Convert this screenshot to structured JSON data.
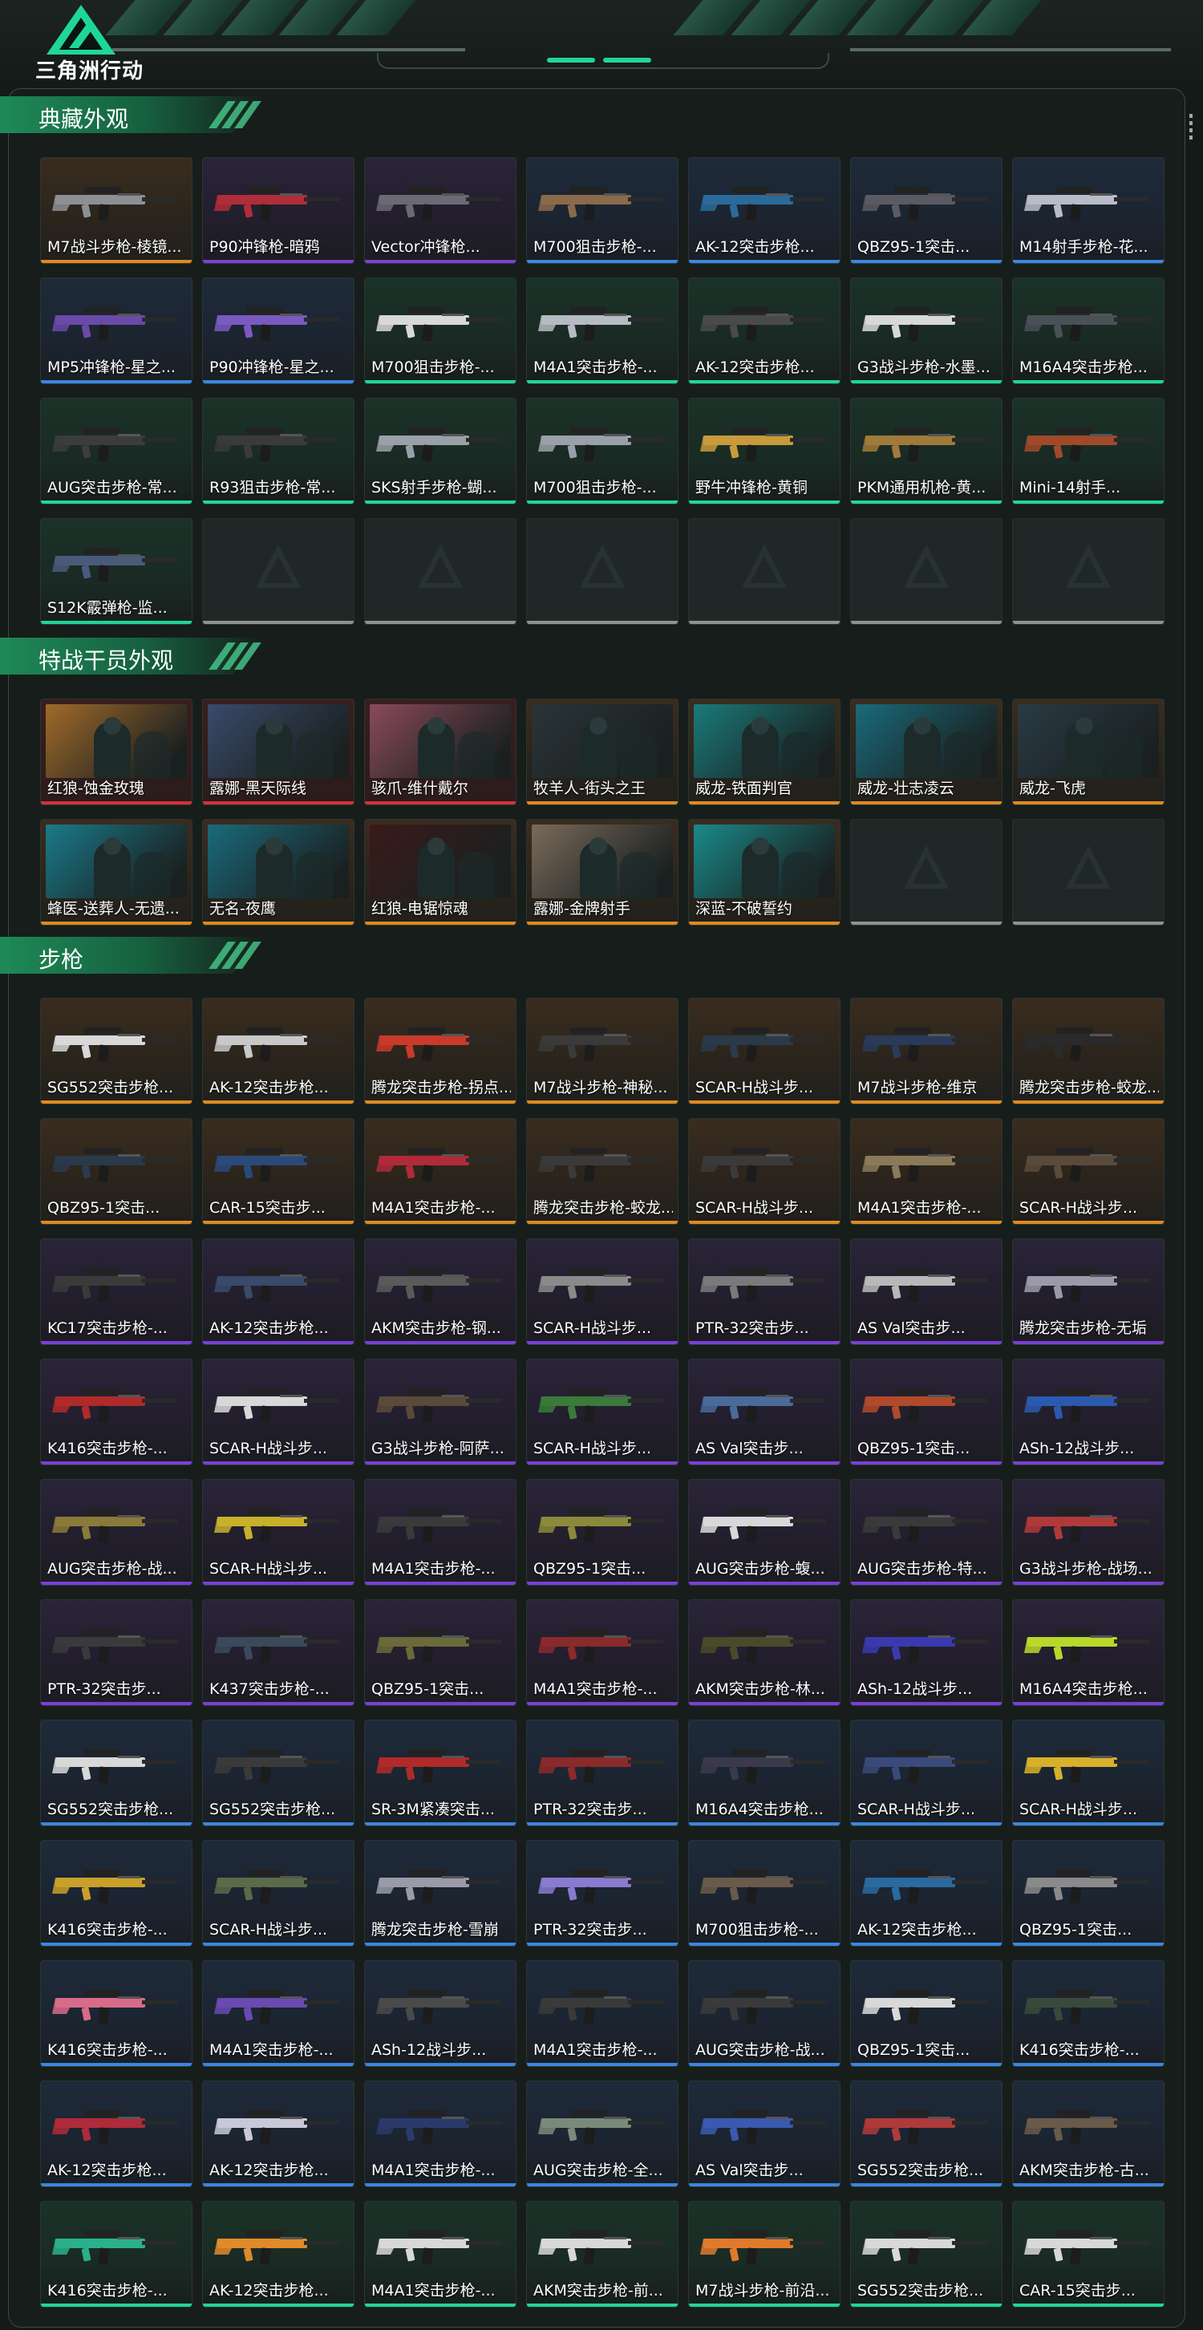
{
  "app": {
    "title": "三角洲行动"
  },
  "colors": {
    "accent": "#1fd69a",
    "gold": "#e08a1c",
    "purple": "#7b3fd6",
    "blue": "#3a86e0",
    "green": "#1fd69a",
    "red": "#d6303a",
    "empty": "#8a9491"
  },
  "sections": [
    {
      "id": "collection",
      "title": "典藏外观",
      "kind": "gun",
      "items": [
        {
          "label": "M7战斗步枪-棱镜...",
          "rarity": "gold",
          "hue": "#8c8f94"
        },
        {
          "label": "P90冲锋枪-暗鸦",
          "rarity": "purple",
          "hue": "#b02d3a"
        },
        {
          "label": "Vector冲锋枪...",
          "rarity": "purple",
          "hue": "#6a6a74"
        },
        {
          "label": "M700狙击步枪-...",
          "rarity": "blue",
          "hue": "#8a6a4a"
        },
        {
          "label": "AK-12突击步枪...",
          "rarity": "blue",
          "hue": "#2a6a9a"
        },
        {
          "label": "QBZ95-1突击...",
          "rarity": "blue",
          "hue": "#5a5a62"
        },
        {
          "label": "M14射手步枪-花...",
          "rarity": "blue",
          "hue": "#b8bcc8"
        },
        {
          "label": "MP5冲锋枪-星之...",
          "rarity": "blue",
          "hue": "#6a4aa8"
        },
        {
          "label": "P90冲锋枪-星之...",
          "rarity": "blue",
          "hue": "#7a5ac0"
        },
        {
          "label": "M700狙击步枪-...",
          "rarity": "green",
          "hue": "#d8d8d8"
        },
        {
          "label": "M4A1突击步枪-...",
          "rarity": "green",
          "hue": "#b6bac2"
        },
        {
          "label": "AK-12突击步枪...",
          "rarity": "green",
          "hue": "#4a4a4a"
        },
        {
          "label": "G3战斗步枪-水墨...",
          "rarity": "green",
          "hue": "#d8d8d8"
        },
        {
          "label": "M16A4突击步枪...",
          "rarity": "green",
          "hue": "#4a5058"
        },
        {
          "label": "AUG突击步枪-常...",
          "rarity": "green",
          "hue": "#3c3c3c"
        },
        {
          "label": "R93狙击步枪-常...",
          "rarity": "green",
          "hue": "#3a3a3a"
        },
        {
          "label": "SKS射手步枪-蝴...",
          "rarity": "green",
          "hue": "#9aa0a8"
        },
        {
          "label": "M700狙击步枪-...",
          "rarity": "green",
          "hue": "#9aa0aa"
        },
        {
          "label": "野牛冲锋枪-黄铜",
          "rarity": "green",
          "hue": "#c89a3a"
        },
        {
          "label": "PKM通用机枪-黄...",
          "rarity": "green",
          "hue": "#a07a3a"
        },
        {
          "label": "Mini-14射手...",
          "rarity": "green",
          "hue": "#a04a2a"
        },
        {
          "label": "S12K霰弹枪-监...",
          "rarity": "green",
          "hue": "#4a5a7a"
        },
        {
          "label": "",
          "rarity": "empty"
        },
        {
          "label": "",
          "rarity": "empty"
        },
        {
          "label": "",
          "rarity": "empty"
        },
        {
          "label": "",
          "rarity": "empty"
        },
        {
          "label": "",
          "rarity": "empty"
        },
        {
          "label": "",
          "rarity": "empty"
        }
      ]
    },
    {
      "id": "operators",
      "title": "特战干员外观",
      "kind": "operator",
      "items": [
        {
          "label": "红狼-蚀金玫瑰",
          "rarity": "red",
          "hue": "#a06a2a"
        },
        {
          "label": "露娜-黑天际线",
          "rarity": "red",
          "hue": "#3a4a6a"
        },
        {
          "label": "骇爪-维什戴尔",
          "rarity": "red",
          "hue": "#8a4a5a"
        },
        {
          "label": "牧羊人-街头之王",
          "rarity": "gold",
          "hue": "#2a3438"
        },
        {
          "label": "威龙-铁面判官",
          "rarity": "gold",
          "hue": "#1a7a7a"
        },
        {
          "label": "威龙-壮志凌云",
          "rarity": "gold",
          "hue": "#1a6a7a"
        },
        {
          "label": "威龙-飞虎",
          "rarity": "gold",
          "hue": "#2a3a44"
        },
        {
          "label": "蜂医-送葬人-无遗...",
          "rarity": "gold",
          "hue": "#1a7a8a"
        },
        {
          "label": "无名-夜鹰",
          "rarity": "gold",
          "hue": "#1a6a7a"
        },
        {
          "label": "红狼-电锯惊魂",
          "rarity": "gold",
          "hue": "#3a1a1a"
        },
        {
          "label": "露娜-金牌射手",
          "rarity": "gold",
          "hue": "#7a6a5a"
        },
        {
          "label": "深蓝-不破誓约",
          "rarity": "gold",
          "hue": "#1a8a8a"
        },
        {
          "label": "",
          "rarity": "empty"
        },
        {
          "label": "",
          "rarity": "empty"
        }
      ]
    },
    {
      "id": "rifles",
      "title": "步枪",
      "kind": "gun",
      "items": [
        {
          "label": "SG552突击步枪...",
          "rarity": "gold",
          "hue": "#d8d8d8"
        },
        {
          "label": "AK-12突击步枪...",
          "rarity": "gold",
          "hue": "#c8c8c8"
        },
        {
          "label": "腾龙突击步枪-拐点...",
          "rarity": "gold",
          "hue": "#c83a2a"
        },
        {
          "label": "M7战斗步枪-神秘...",
          "rarity": "gold",
          "hue": "#3a3a3a"
        },
        {
          "label": "SCAR-H战斗步...",
          "rarity": "gold",
          "hue": "#2a3a4a"
        },
        {
          "label": "M7战斗步枪-维京",
          "rarity": "gold",
          "hue": "#2a3a5a"
        },
        {
          "label": "腾龙突击步枪-蛟龙...",
          "rarity": "gold",
          "hue": "#2a2a2a"
        },
        {
          "label": "QBZ95-1突击...",
          "rarity": "gold",
          "hue": "#2a3a4a"
        },
        {
          "label": "CAR-15突击步...",
          "rarity": "gold",
          "hue": "#2a4a7a"
        },
        {
          "label": "M4A1突击步枪-...",
          "rarity": "gold",
          "hue": "#b02a3a"
        },
        {
          "label": "腾龙突击步枪-蛟龙...",
          "rarity": "gold",
          "hue": "#3a3a3a"
        },
        {
          "label": "SCAR-H战斗步...",
          "rarity": "gold",
          "hue": "#3a3a3a"
        },
        {
          "label": "M4A1突击步枪-...",
          "rarity": "gold",
          "hue": "#8a7a5a"
        },
        {
          "label": "SCAR-H战斗步...",
          "rarity": "gold",
          "hue": "#5a4a3a"
        },
        {
          "label": "KC17突击步枪-...",
          "rarity": "purple",
          "hue": "#3a3a3a"
        },
        {
          "label": "AK-12突击步枪...",
          "rarity": "purple",
          "hue": "#3a4a6a"
        },
        {
          "label": "AKM突击步枪-钢...",
          "rarity": "purple",
          "hue": "#5a5a5a"
        },
        {
          "label": "SCAR-H战斗步...",
          "rarity": "purple",
          "hue": "#8a8a8a"
        },
        {
          "label": "PTR-32突击步...",
          "rarity": "purple",
          "hue": "#7a7a7a"
        },
        {
          "label": "AS Val突击步...",
          "rarity": "purple",
          "hue": "#b8b8b8"
        },
        {
          "label": "腾龙突击步枪-无垢",
          "rarity": "purple",
          "hue": "#9a9aaa"
        },
        {
          "label": "K416突击步枪-...",
          "rarity": "purple",
          "hue": "#b02a2a"
        },
        {
          "label": "SCAR-H战斗步...",
          "rarity": "purple",
          "hue": "#d8d8d8"
        },
        {
          "label": "G3战斗步枪-阿萨...",
          "rarity": "purple",
          "hue": "#5a4a3a"
        },
        {
          "label": "SCAR-H战斗步...",
          "rarity": "purple",
          "hue": "#3a7a3a"
        },
        {
          "label": "AS Val突击步...",
          "rarity": "purple",
          "hue": "#4a6a9a"
        },
        {
          "label": "QBZ95-1突击...",
          "rarity": "purple",
          "hue": "#b04a2a"
        },
        {
          "label": "ASh-12战斗步...",
          "rarity": "purple",
          "hue": "#2a5ab0"
        },
        {
          "label": "AUG突击步枪-战...",
          "rarity": "purple",
          "hue": "#8a7a3a"
        },
        {
          "label": "SCAR-H战斗步...",
          "rarity": "purple",
          "hue": "#c8b02a"
        },
        {
          "label": "M4A1突击步枪-...",
          "rarity": "purple",
          "hue": "#3a3a3a"
        },
        {
          "label": "QBZ95-1突击...",
          "rarity": "purple",
          "hue": "#8a8a3a"
        },
        {
          "label": "AUG突击步枪-蝮...",
          "rarity": "purple",
          "hue": "#d8d8d8"
        },
        {
          "label": "AUG突击步枪-特...",
          "rarity": "purple",
          "hue": "#3a3a3a"
        },
        {
          "label": "G3战斗步枪-战场...",
          "rarity": "purple",
          "hue": "#b03a3a"
        },
        {
          "label": "PTR-32突击步...",
          "rarity": "purple",
          "hue": "#3a3a3a"
        },
        {
          "label": "K437突击步枪-...",
          "rarity": "purple",
          "hue": "#3a4a5a"
        },
        {
          "label": "QBZ95-1突击...",
          "rarity": "purple",
          "hue": "#6a6a3a"
        },
        {
          "label": "M4A1突击步枪-...",
          "rarity": "purple",
          "hue": "#8a2a2a"
        },
        {
          "label": "AKM突击步枪-林...",
          "rarity": "purple",
          "hue": "#4a4a2a"
        },
        {
          "label": "ASh-12战斗步...",
          "rarity": "purple",
          "hue": "#3a3ab0"
        },
        {
          "label": "M16A4突击步枪...",
          "rarity": "purple",
          "hue": "#b8d82a"
        },
        {
          "label": "SG552突击步枪...",
          "rarity": "blue",
          "hue": "#d8d8d8"
        },
        {
          "label": "SG552突击步枪...",
          "rarity": "blue",
          "hue": "#3a3a3a"
        },
        {
          "label": "SR-3M紧凑突击...",
          "rarity": "blue",
          "hue": "#b02a2a"
        },
        {
          "label": "PTR-32突击步...",
          "rarity": "blue",
          "hue": "#8a2a2a"
        },
        {
          "label": "M16A4突击步枪...",
          "rarity": "blue",
          "hue": "#3a3a4a"
        },
        {
          "label": "SCAR-H战斗步...",
          "rarity": "blue",
          "hue": "#3a4a7a"
        },
        {
          "label": "SCAR-H战斗步...",
          "rarity": "blue",
          "hue": "#d8b02a"
        },
        {
          "label": "K416突击步枪-...",
          "rarity": "blue",
          "hue": "#c8a02a"
        },
        {
          "label": "SCAR-H战斗步...",
          "rarity": "blue",
          "hue": "#5a6a4a"
        },
        {
          "label": "腾龙突击步枪-雪崩",
          "rarity": "blue",
          "hue": "#9a9aa8"
        },
        {
          "label": "PTR-32突击步...",
          "rarity": "blue",
          "hue": "#8a7ad0"
        },
        {
          "label": "M700狙击步枪-...",
          "rarity": "blue",
          "hue": "#6a5a4a"
        },
        {
          "label": "AK-12突击步枪...",
          "rarity": "blue",
          "hue": "#2a6aa0"
        },
        {
          "label": "QBZ95-1突击...",
          "rarity": "blue",
          "hue": "#8a8a8a"
        },
        {
          "label": "K416突击步枪-...",
          "rarity": "blue",
          "hue": "#d86a8a"
        },
        {
          "label": "M4A1突击步枪-...",
          "rarity": "blue",
          "hue": "#6a4ab0"
        },
        {
          "label": "ASh-12战斗步...",
          "rarity": "blue",
          "hue": "#4a4a4a"
        },
        {
          "label": "M4A1突击步枪-...",
          "rarity": "blue",
          "hue": "#3a3a3a"
        },
        {
          "label": "AUG突击步枪-战...",
          "rarity": "blue",
          "hue": "#3a3a3a"
        },
        {
          "label": "QBZ95-1突击...",
          "rarity": "blue",
          "hue": "#d8d8d8"
        },
        {
          "label": "K416突击步枪-...",
          "rarity": "blue",
          "hue": "#3a4a3a"
        },
        {
          "label": "AK-12突击步枪...",
          "rarity": "blue",
          "hue": "#b02a3a"
        },
        {
          "label": "AK-12突击步枪...",
          "rarity": "blue",
          "hue": "#c8c8d8"
        },
        {
          "label": "M4A1突击步枪-...",
          "rarity": "blue",
          "hue": "#2a3a6a"
        },
        {
          "label": "AUG突击步枪-全...",
          "rarity": "blue",
          "hue": "#7a8a7a"
        },
        {
          "label": "AS Val突击步...",
          "rarity": "blue",
          "hue": "#3a5ab0"
        },
        {
          "label": "SG552突击步枪...",
          "rarity": "blue",
          "hue": "#b03a3a"
        },
        {
          "label": "AKM突击步枪-古...",
          "rarity": "blue",
          "hue": "#6a5a4a"
        },
        {
          "label": "K416突击步枪-...",
          "rarity": "green",
          "hue": "#2ab08a"
        },
        {
          "label": "AK-12突击步枪...",
          "rarity": "green",
          "hue": "#e08a2a"
        },
        {
          "label": "M4A1突击步枪-...",
          "rarity": "green",
          "hue": "#d8d8d8"
        },
        {
          "label": "AKM突击步枪-前...",
          "rarity": "green",
          "hue": "#d8d8d8"
        },
        {
          "label": "M7战斗步枪-前沿...",
          "rarity": "green",
          "hue": "#e07a2a"
        },
        {
          "label": "SG552突击步枪...",
          "rarity": "green",
          "hue": "#d8d8d8"
        },
        {
          "label": "CAR-15突击步...",
          "rarity": "green",
          "hue": "#d8d8d8"
        }
      ]
    }
  ]
}
